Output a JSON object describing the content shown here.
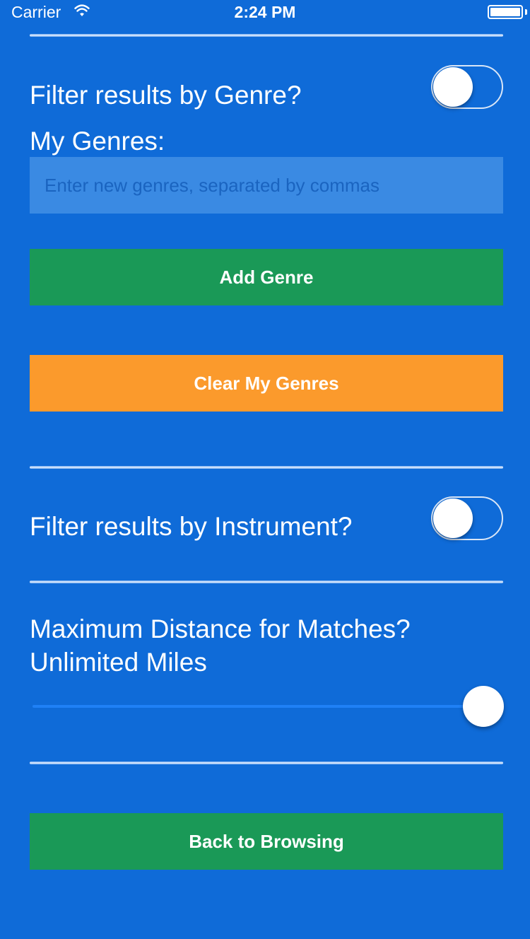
{
  "status_bar": {
    "carrier": "Carrier",
    "time": "2:24 PM",
    "battery_level": 1.0
  },
  "genre_filter": {
    "label": "Filter results by Genre?",
    "enabled": false
  },
  "my_genres": {
    "label": "My Genres:",
    "input_value": "",
    "input_placeholder": "Enter new genres, separated by commas"
  },
  "buttons": {
    "add_genre": "Add Genre",
    "clear_genres": "Clear My Genres",
    "back_to_browsing": "Back to Browsing"
  },
  "instrument_filter": {
    "label": "Filter results by Instrument?",
    "enabled": false
  },
  "distance": {
    "label": "Maximum Distance for Matches?",
    "value_text": "Unlimited Miles",
    "slider_value_fraction": 1.0
  },
  "colors": {
    "background": "#0f6bd8",
    "green_button": "#1a9957",
    "orange_button": "#fb9a2c",
    "input_background": "#3a8ae3",
    "slider_track": "#1f80f5"
  },
  "icons": {
    "wifi": "wifi-icon",
    "battery": "battery-icon"
  }
}
